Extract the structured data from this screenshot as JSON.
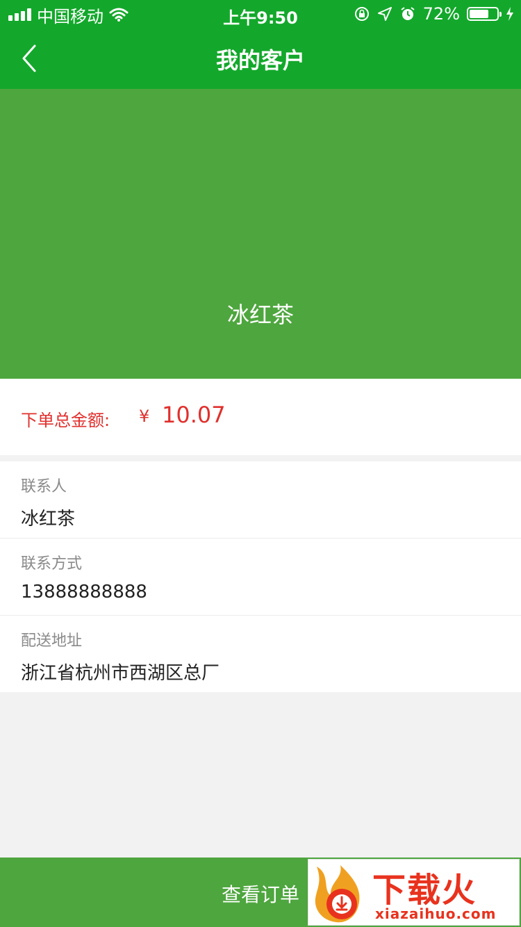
{
  "status_bar": {
    "carrier": "中国移动",
    "time": "上午9:50",
    "battery_percent": "72%",
    "battery_level": 0.72,
    "icons": [
      "signal-icon",
      "wifi-icon",
      "rotation-lock-icon",
      "location-icon",
      "alarm-icon",
      "battery-icon",
      "charging-icon"
    ]
  },
  "nav": {
    "title": "我的客户",
    "back_icon": "chevron-left-icon"
  },
  "banner": {
    "name": "冰红茶"
  },
  "total": {
    "label": "下单总金额:",
    "currency": "¥",
    "value": "10.07"
  },
  "info": {
    "rows": [
      {
        "label": "联系人",
        "value": "冰红茶"
      },
      {
        "label": "联系方式",
        "value": "13888888888"
      },
      {
        "label": "配送地址",
        "value": "浙江省杭州市西湖区总厂"
      }
    ]
  },
  "bottom": {
    "button_label": "查看订单"
  },
  "watermark": {
    "brand": "下载火",
    "url": "xiazaihuo.com"
  },
  "colors": {
    "nav_green": "#13a82b",
    "banner_green": "#4ea63e",
    "accent_red": "#e0302d",
    "background": "#f2f2f2"
  }
}
